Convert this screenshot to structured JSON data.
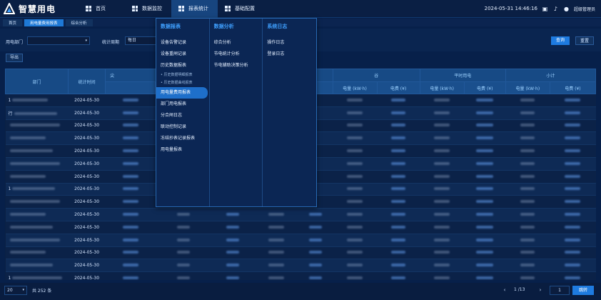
{
  "app": {
    "title": "智慧用电"
  },
  "nav": [
    {
      "label": "首页",
      "icon": "home-icon"
    },
    {
      "label": "数据监控",
      "icon": "monitor-icon"
    },
    {
      "label": "报表统计",
      "icon": "report-icon",
      "active": true
    },
    {
      "label": "基础配置",
      "icon": "config-icon"
    }
  ],
  "header": {
    "datetime": "2024-05-31 14:46:16",
    "user": "超级管理员"
  },
  "tabs": [
    {
      "label": "首页"
    },
    {
      "label": "用电量费用报表",
      "active": true
    },
    {
      "label": "综合分析"
    }
  ],
  "filters": {
    "dept_label": "用电部门",
    "dept_value": "",
    "period_label": "统计周期",
    "period_value": "每日",
    "search_label": "查询",
    "reset_label": "重置"
  },
  "export_label": "导出",
  "table": {
    "group_headers": [
      "尖",
      "谷",
      "平时用电",
      "小计"
    ],
    "col_dept": "部门",
    "col_time": "统计时间",
    "sub_headers": [
      "电量 (kW·h)",
      "电费 (¥)"
    ],
    "rows": [
      {
        "dept": "1",
        "date": "2024-05-30"
      },
      {
        "dept": "行",
        "date": "2024-05-30"
      },
      {
        "dept": "",
        "date": "2024-05-30"
      },
      {
        "dept": "",
        "date": "2024-05-30"
      },
      {
        "dept": "",
        "date": "2024-05-30"
      },
      {
        "dept": "",
        "date": "2024-05-30"
      },
      {
        "dept": "",
        "date": "2024-05-30"
      },
      {
        "dept": "1",
        "date": "2024-05-30"
      },
      {
        "dept": "",
        "date": "2024-05-30"
      },
      {
        "dept": "",
        "date": "2024-05-30"
      },
      {
        "dept": "",
        "date": "2024-05-30"
      },
      {
        "dept": "",
        "date": "2024-05-30"
      },
      {
        "dept": "",
        "date": "2024-05-30"
      },
      {
        "dept": "",
        "date": "2024-05-30"
      },
      {
        "dept": "1",
        "date": "2024-05-30"
      }
    ]
  },
  "menu": {
    "columns": [
      {
        "title": "数据报表",
        "items": [
          {
            "label": "设备告警记录"
          },
          {
            "label": "设备重闸记录"
          },
          {
            "label": "历史数据报表"
          },
          {
            "label": "• 历史数据明细报表",
            "sub": true
          },
          {
            "label": "• 历史数据曲线报表",
            "sub": true
          },
          {
            "label": "用电量费用报表",
            "active": true
          },
          {
            "label": "部门用电报表"
          },
          {
            "label": "分合闸日志"
          },
          {
            "label": "联动控制记录"
          },
          {
            "label": "冻结抄表记录报表"
          },
          {
            "label": "用电量报表"
          }
        ]
      },
      {
        "title": "数据分析",
        "items": [
          {
            "label": "综合分析"
          },
          {
            "label": "节电统计分析"
          },
          {
            "label": "节电辅助决策分析"
          }
        ]
      },
      {
        "title": "系统日志",
        "items": [
          {
            "label": "操作日志"
          },
          {
            "label": "登录日志"
          }
        ]
      }
    ]
  },
  "footer": {
    "page_size": "20",
    "total": "共 252 条",
    "page_text": "1 /13",
    "page_input": "1",
    "go_label": "跳转"
  }
}
